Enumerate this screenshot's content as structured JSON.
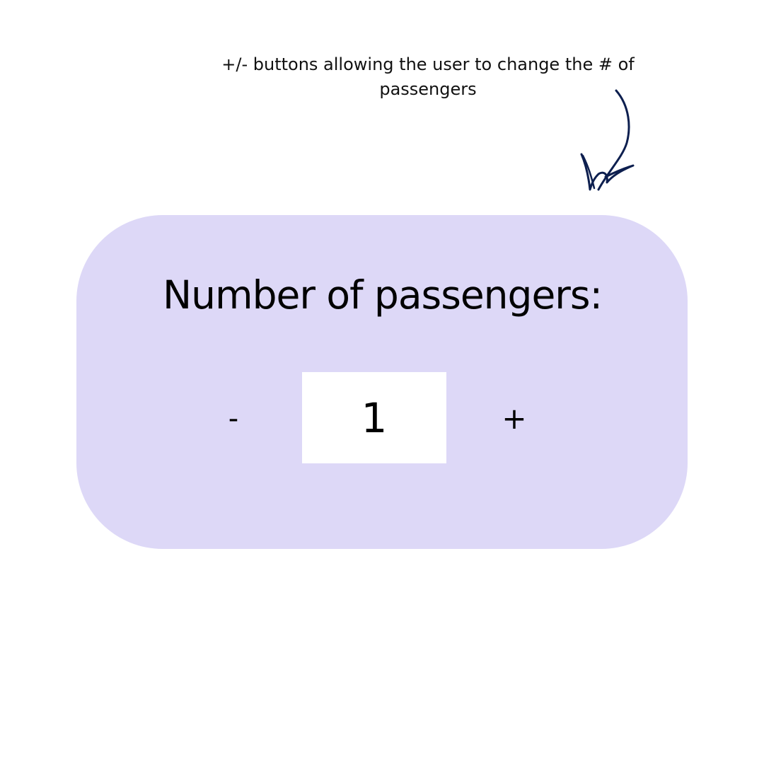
{
  "annotation": {
    "line1": "+/- buttons allowing the user to change the # of",
    "line2": "passengers",
    "arrow_icon": "hand-drawn-arrow-icon",
    "arrow_color": "#0d1f4f"
  },
  "card": {
    "title": "Number of passengers:",
    "background_color": "#ddd8f7",
    "decrement_label": "-",
    "increment_label": "+",
    "value": "1"
  }
}
